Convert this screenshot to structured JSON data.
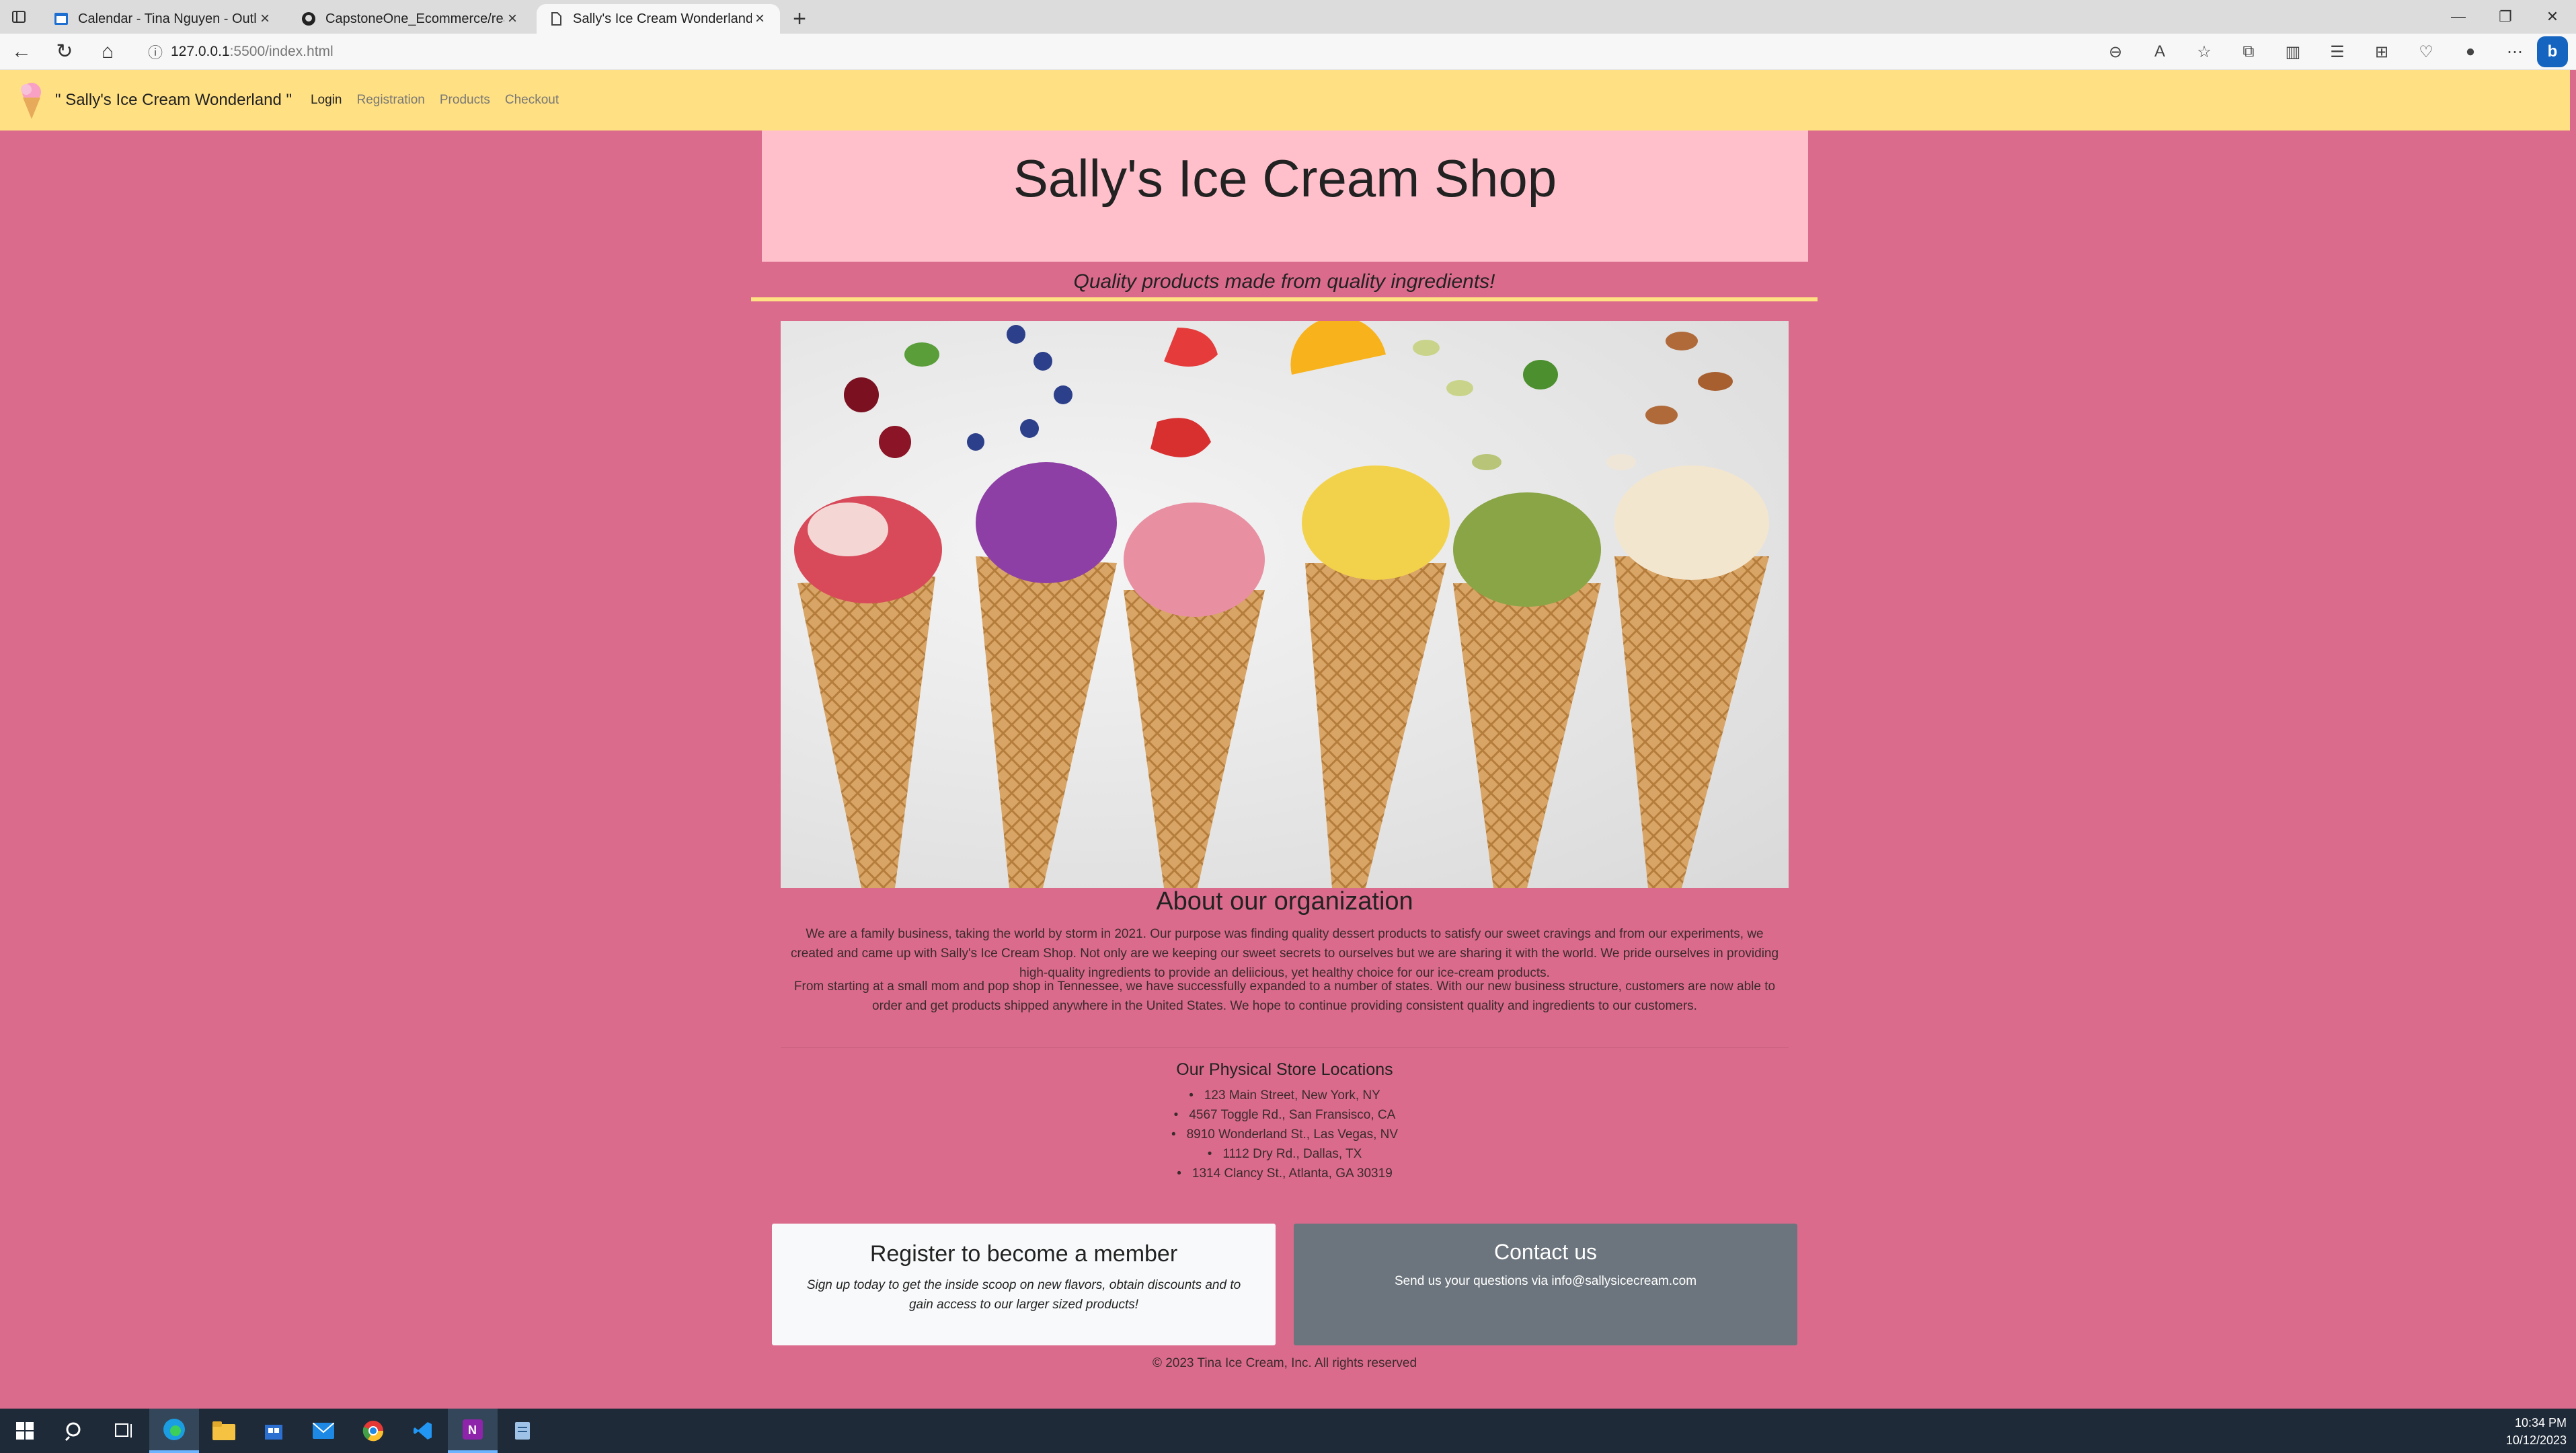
{
  "browser": {
    "tabs": [
      {
        "title": "Calendar - Tina Nguyen - Outlook",
        "active": false,
        "icon": "outlook-calendar-icon"
      },
      {
        "title": "CapstoneOne_Ecommerce/readme",
        "active": false,
        "icon": "github-icon"
      },
      {
        "title": "Sally's Ice Cream Wonderland!",
        "active": true,
        "icon": "page-icon"
      }
    ],
    "url_host": "127.0.0.1",
    "url_path": ":5500/index.html"
  },
  "site": {
    "brand": "\" Sally's Ice Cream Wonderland \"",
    "nav": [
      "Login",
      "Registration",
      "Products",
      "Checkout"
    ],
    "hero_title": "Sally's Ice Cream Shop",
    "tagline": "Quality products made from quality ingredients!",
    "about_title": "About our organization",
    "about_p1": "We are a family business, taking the world by storm in 2021. Our purpose was finding quality dessert products to satisfy our sweet cravings and from our experiments, we created and came up with Sally's Ice Cream Shop. Not only are we keeping our sweet secrets to ourselves but we are sharing it with the world. We pride ourselves in providing high-quality ingredients to provide an deliicious, yet healthy choice for our ice-cream products.",
    "about_p2": "From starting at a small mom and pop shop in Tennessee, we have successfully expanded to a number of states. With our new business structure, customers are now able to order and get products shipped anywhere in the United States. We hope to continue providing consistent quality and ingredients to our customers.",
    "locations_title": "Our Physical Store Locations",
    "locations": [
      "123 Main Street, New York, NY",
      "4567 Toggle Rd., San Fransisco, CA",
      "8910 Wonderland St., Las Vegas, NV",
      "1112 Dry Rd., Dallas, TX",
      "1314 Clancy St., Atlanta, GA 30319"
    ],
    "register_title": "Register to become a member",
    "register_text": "Sign up today to get the inside scoop on new flavors, obtain discounts and to gain access to our larger sized products!",
    "contact_title": "Contact us",
    "contact_text": "Send us your questions via info@sallysicecream.com",
    "footer": "© 2023 Tina Ice Cream, Inc. All rights reserved"
  },
  "taskbar": {
    "time": "10:34 PM",
    "date": "10/12/2023"
  },
  "colors": {
    "page_bg": "#db6b8c",
    "navbar_bg": "#ffe082",
    "hero_bg": "#ffc0cb",
    "contact_card_bg": "#6c757d"
  }
}
